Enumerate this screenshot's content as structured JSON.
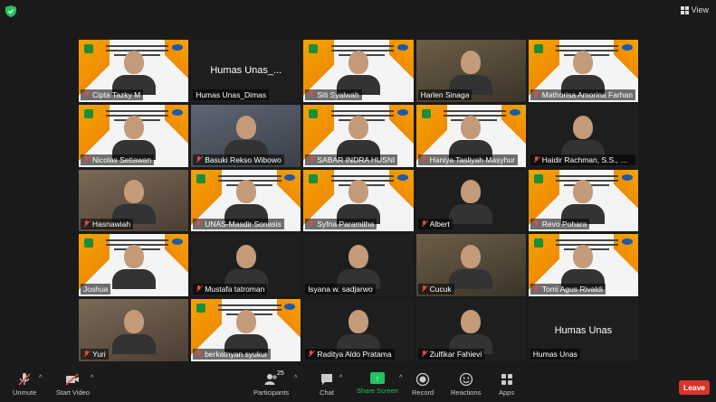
{
  "app": {
    "view_label": "View"
  },
  "participants": [
    {
      "name": "Cipta Tazky M",
      "type": "slide",
      "muted": true
    },
    {
      "name": "Humas Unas_Dimas",
      "type": "name",
      "center": "Humas  Unas_...",
      "muted": false
    },
    {
      "name": "Siti Syalwah",
      "type": "slide",
      "muted": true
    },
    {
      "name": "Harlen Sinaga",
      "type": "photo",
      "speaking": true,
      "muted": false
    },
    {
      "name": "Mathorisa Amorina Farhan",
      "type": "slide",
      "muted": true
    },
    {
      "name": "Nicolas Setiawan",
      "type": "slide",
      "muted": true
    },
    {
      "name": "Basuki Rekso Wibowo",
      "type": "photo",
      "muted": true
    },
    {
      "name": "SABAR INDRA HUSNI",
      "type": "slide",
      "muted": true
    },
    {
      "name": "Haniya Tasliyah Masyhur",
      "type": "slide",
      "muted": true
    },
    {
      "name": "Haidir Rachman, S.S., S.H., ...",
      "type": "dark",
      "muted": true
    },
    {
      "name": "Hasnawiah",
      "type": "photo",
      "muted": true
    },
    {
      "name": "UNAS-Masdir Sonasis",
      "type": "slide",
      "muted": true
    },
    {
      "name": "Syfna Paramitha",
      "type": "slide",
      "muted": true
    },
    {
      "name": "Albert",
      "type": "dark",
      "muted": true
    },
    {
      "name": "Revo Pohara",
      "type": "slide",
      "muted": true
    },
    {
      "name": "Joshua",
      "type": "slide",
      "muted": false
    },
    {
      "name": "Mustafa tatroman",
      "type": "dark",
      "muted": true
    },
    {
      "name": "lsyana w. sadjarwo",
      "type": "dark",
      "muted": false
    },
    {
      "name": "Cucuk",
      "type": "photo",
      "muted": true
    },
    {
      "name": "Tomi Agus Rivaldi",
      "type": "slide",
      "muted": true
    },
    {
      "name": "Yuri",
      "type": "photo",
      "muted": true
    },
    {
      "name": "berkatnyan syukur",
      "type": "slide",
      "muted": true
    },
    {
      "name": "Raditya Aldo Pratama",
      "type": "dark",
      "muted": true
    },
    {
      "name": "Zulfikar Fahievi",
      "type": "dark",
      "muted": true
    },
    {
      "name": "Humas Unas",
      "type": "name",
      "center": "Humas Unas",
      "muted": false
    }
  ],
  "toolbar": {
    "unmute": "Unmute",
    "start_video": "Start Video",
    "participants": "Participants",
    "participants_count": "25",
    "chat": "Chat",
    "share_screen": "Share Screen",
    "record": "Record",
    "reactions": "Reactions",
    "apps": "Apps",
    "leave": "Leave"
  },
  "colors": {
    "accent_share": "#23c45e",
    "leave": "#d9342b",
    "speaking": "#f5d327",
    "muted": "#e74c3c"
  }
}
